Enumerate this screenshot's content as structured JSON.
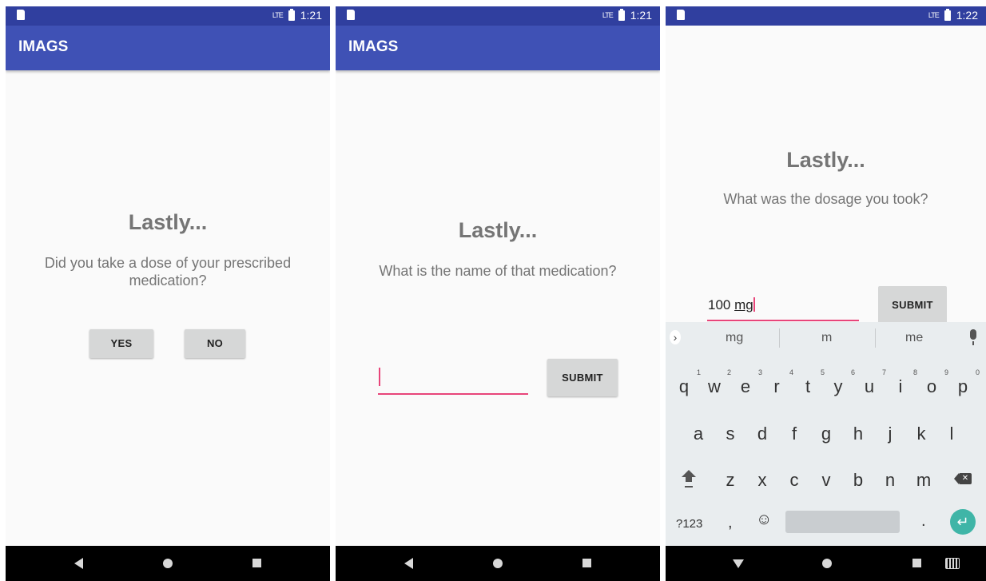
{
  "app_title": "IMAGS",
  "screens": [
    {
      "time": "1:21",
      "network": "LTE",
      "heading": "Lastly...",
      "question": "Did you take a dose of your prescribed medication?",
      "yes_label": "YES",
      "no_label": "NO"
    },
    {
      "time": "1:21",
      "network": "LTE",
      "heading": "Lastly...",
      "question": "What is the name of that medication?",
      "input_value": "",
      "submit_label": "SUBMIT"
    },
    {
      "time": "1:22",
      "network": "LTE",
      "heading": "Lastly...",
      "question": "What was the dosage you took?",
      "input_prefix": "100 ",
      "input_underlined": "mg",
      "submit_label": "SUBMIT"
    }
  ],
  "keyboard": {
    "suggestions": [
      "mg",
      "m",
      "me"
    ],
    "row1": [
      "q",
      "w",
      "e",
      "r",
      "t",
      "y",
      "u",
      "i",
      "o",
      "p"
    ],
    "row1_numbers": [
      "1",
      "2",
      "3",
      "4",
      "5",
      "6",
      "7",
      "8",
      "9",
      "0"
    ],
    "row2": [
      "a",
      "s",
      "d",
      "f",
      "g",
      "h",
      "j",
      "k",
      "l"
    ],
    "row3": [
      "z",
      "x",
      "c",
      "v",
      "b",
      "n",
      "m"
    ],
    "symbols_key": "?123",
    "comma_key": ",",
    "emoji_key": "☺",
    "period_key": ".",
    "enter_key": "↵",
    "expand_key": "›"
  },
  "colors": {
    "status_bar": "#303f9f",
    "app_bar": "#3f51b5",
    "accent": "#e8457a",
    "button": "#d6d7d7",
    "enter": "#3fb5a7"
  },
  "icons": [
    "sd-card-icon",
    "signal-icon",
    "battery-icon",
    "back-icon",
    "home-icon",
    "recents-icon",
    "hide-keyboard-icon",
    "keyboard-switch-icon",
    "mic-icon",
    "shift-icon",
    "backspace-icon"
  ]
}
